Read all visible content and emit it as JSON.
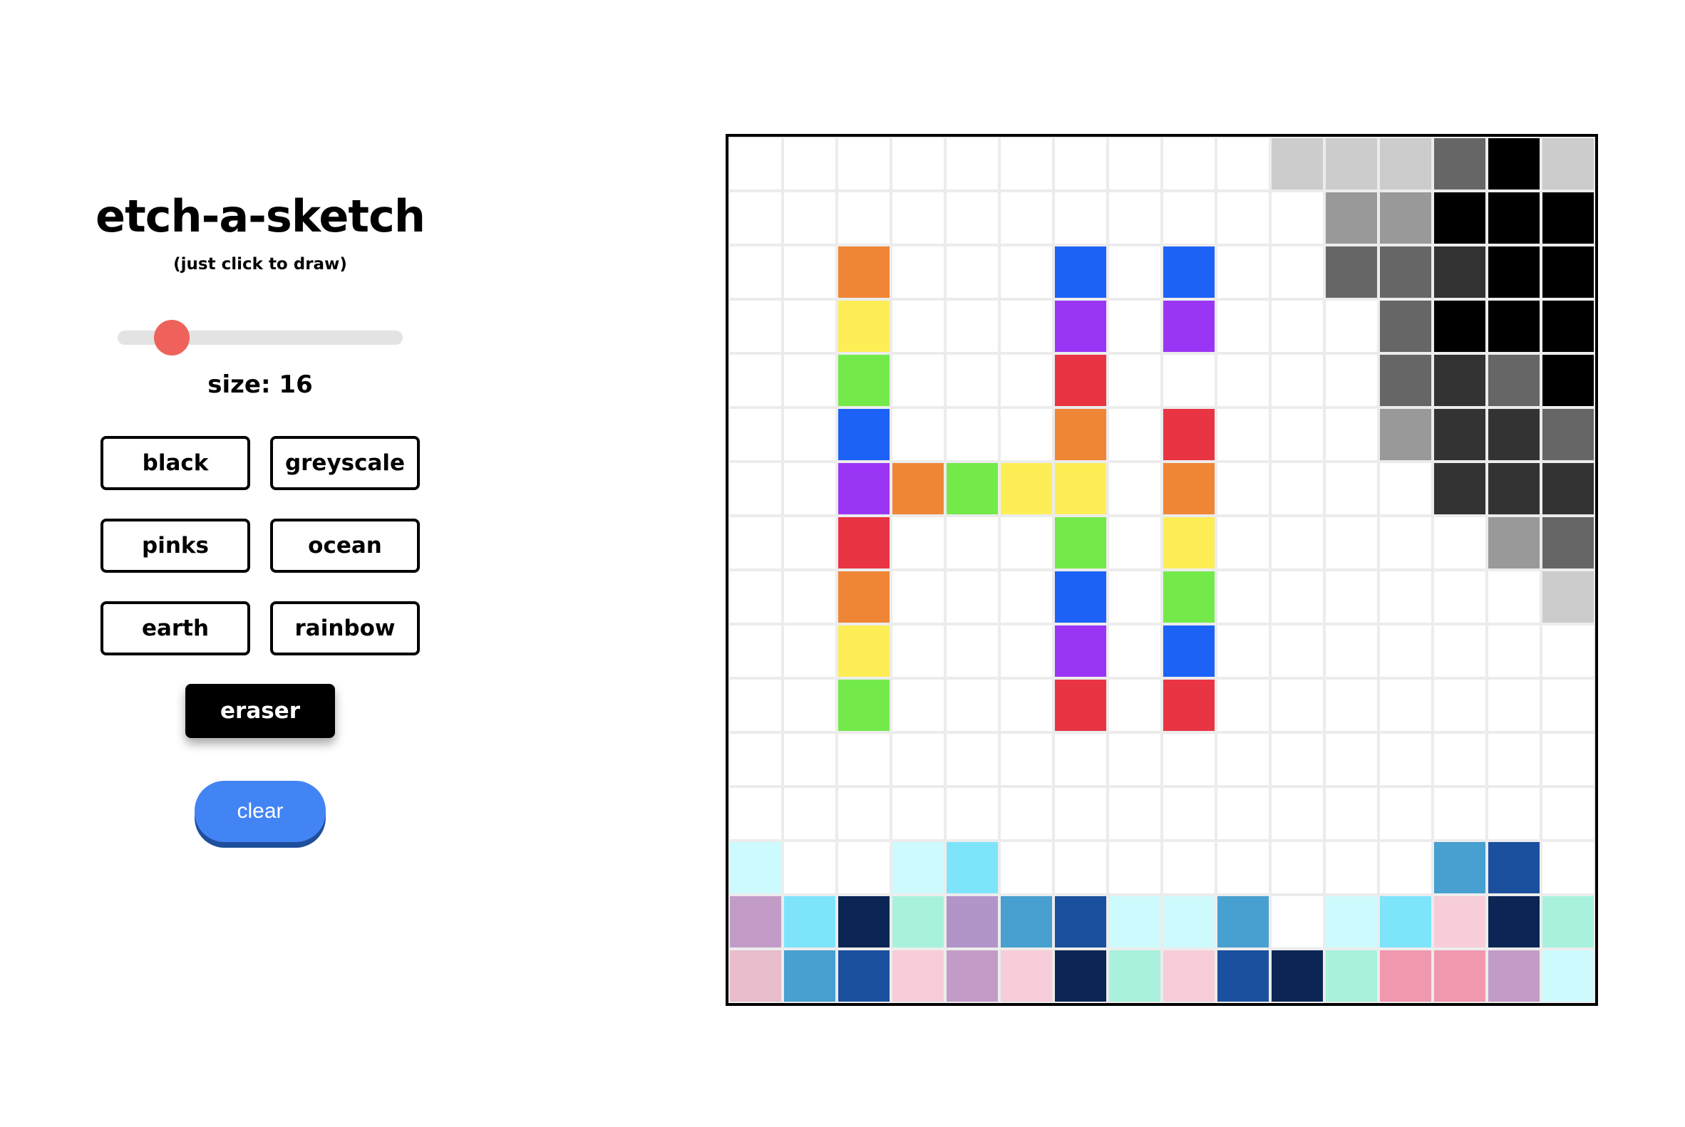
{
  "app": {
    "title": "etch-a-sketch",
    "subtitle": "(just click to draw)",
    "size_label": "size: 16"
  },
  "slider": {
    "value": 16,
    "min": 2,
    "max": 64,
    "fraction": 0.19,
    "thumb_color": "#ee625b"
  },
  "modes": [
    {
      "id": "black",
      "label": "black"
    },
    {
      "id": "greyscale",
      "label": "greyscale"
    },
    {
      "id": "pinks",
      "label": "pinks"
    },
    {
      "id": "ocean",
      "label": "ocean"
    },
    {
      "id": "earth",
      "label": "earth"
    },
    {
      "id": "rainbow",
      "label": "rainbow"
    }
  ],
  "eraser": {
    "label": "eraser",
    "active": true
  },
  "clear": {
    "label": "clear",
    "color": "#4284f4"
  },
  "grid": {
    "size": 16,
    "palette": {
      ".": "#ffffff",
      "a": "#cccccc",
      "b": "#999999",
      "c": "#666666",
      "d": "#333333",
      "e": "#000000",
      "O": "#ef8636",
      "Y": "#fdee55",
      "G": "#74ea4a",
      "B": "#1d62f6",
      "P": "#9b35f5",
      "R": "#e93444",
      "i": "#cdfafd",
      "j": "#7ee4fa",
      "k": "#47a0d0",
      "l": "#1b509f",
      "m": "#0b2655",
      "n": "#a8f2dd",
      "p": "#c29cc6",
      "q": "#b195c8",
      "r": "#e8bdcb",
      "s": "#f6cdd8",
      "t": "#f098ae"
    },
    "rows": [
      "..........aaacea",
      "...........bbeee",
      "..O...B.B..ccdee",
      "..Y...P.P...ceee",
      "..G...R.....cdce",
      "..B...O.R...bddc",
      "..POGYY.O....ddd",
      "..R...G.Y.....bc",
      "..O...B.G......a",
      "..Y...P.B.......",
      "..G...R.R.......",
      "................",
      "................",
      "i..ij........kl.",
      "pjmnqkliik.ijsmn",
      "rklspsmnslmnttpi"
    ]
  }
}
